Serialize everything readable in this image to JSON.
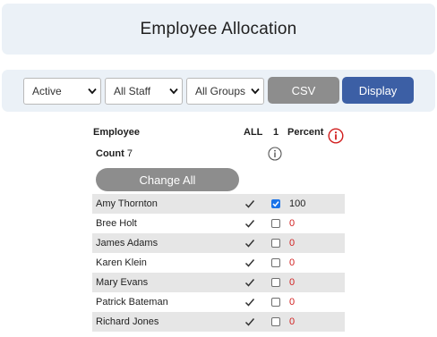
{
  "header": {
    "title": "Employee Allocation"
  },
  "toolbar": {
    "status_select": "Active",
    "staff_select": "All Staff",
    "groups_select": "All Groups",
    "csv_label": "CSV",
    "display_label": "Display"
  },
  "grid": {
    "col_employee": "Employee",
    "col_all": "ALL",
    "col_one": "1",
    "col_percent": "Percent",
    "count_label": "Count",
    "count_value": "7",
    "change_all_label": "Change All"
  },
  "rows": [
    {
      "name": "Amy Thornton",
      "all": true,
      "assigned": true,
      "percent": "100"
    },
    {
      "name": "Bree Holt",
      "all": true,
      "assigned": false,
      "percent": "0"
    },
    {
      "name": "James Adams",
      "all": true,
      "assigned": false,
      "percent": "0"
    },
    {
      "name": "Karen Klein",
      "all": true,
      "assigned": false,
      "percent": "0"
    },
    {
      "name": "Mary Evans",
      "all": true,
      "assigned": false,
      "percent": "0"
    },
    {
      "name": "Patrick Bateman",
      "all": true,
      "assigned": false,
      "percent": "0"
    },
    {
      "name": "Richard Jones",
      "all": true,
      "assigned": false,
      "percent": "0"
    }
  ],
  "colors": {
    "panel_bg": "#ebf1f7",
    "display_button": "#3c5fa5",
    "gray_button": "#8d8d8d",
    "zero_percent": "#d11f1f",
    "info_icon_red": "#d11f1f"
  }
}
